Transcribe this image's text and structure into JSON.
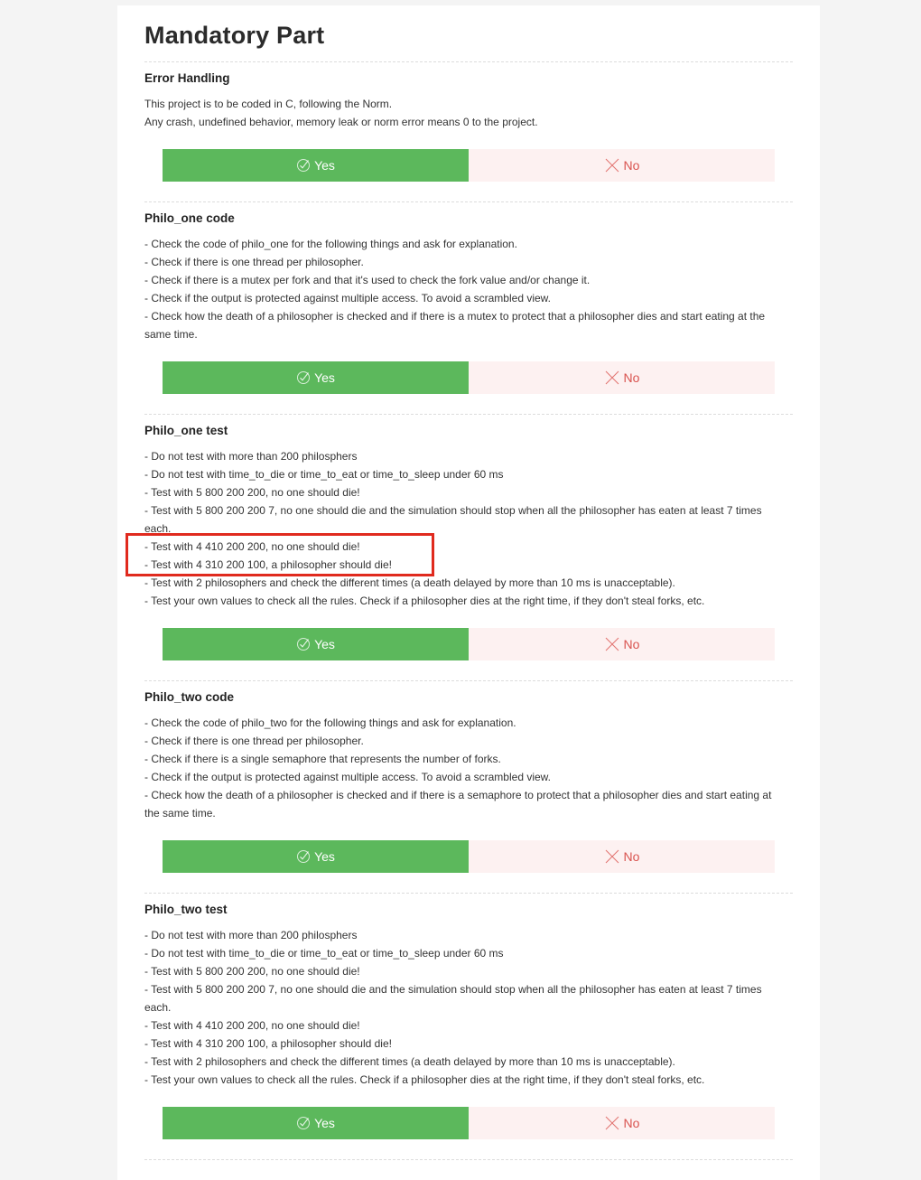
{
  "page": {
    "title": "Mandatory Part"
  },
  "colors": {
    "yes_bg": "#5cb85c",
    "no_bg": "#fdf1f1",
    "no_text": "#d9534f",
    "highlight": "#e02a1e"
  },
  "sections": [
    {
      "title": "Error Handling",
      "lines": [
        "This project is to be coded in C, following the Norm.",
        "Any crash, undefined behavior, memory leak or norm error means 0 to the project."
      ],
      "yes_label": "Yes",
      "no_label": "No"
    },
    {
      "title": "Philo_one code",
      "lines": [
        "- Check the code of philo_one for the following things and ask for explanation.",
        "- Check if there is one thread per philosopher.",
        "- Check if there is a mutex per fork and that it's used to check the fork value and/or change it.",
        "- Check if the output is protected against multiple access. To avoid a scrambled view.",
        "- Check how the death of a philosopher is checked and if there is a mutex to protect that a philosopher dies and start eating at the same time."
      ],
      "yes_label": "Yes",
      "no_label": "No"
    },
    {
      "title": "Philo_one test",
      "lines": [
        "- Do not test with more than 200 philosphers",
        "- Do not test with time_to_die or time_to_eat or time_to_sleep under 60 ms",
        "- Test with 5 800 200 200, no one should die!",
        "- Test with 5 800 200 200 7, no one should die and the simulation should stop when all the philosopher has eaten at least 7 times each.",
        "- Test with 4 410 200 200, no one should die!",
        "- Test with 4 310 200 100, a philosopher should die!",
        "- Test with 2 philosophers and check the different times (a death delayed by more than 10 ms is unacceptable).",
        "- Test your own values to check all the rules. Check if a philosopher dies at the right time, if they don't steal forks, etc."
      ],
      "yes_label": "Yes",
      "no_label": "No"
    },
    {
      "title": "Philo_two code",
      "lines": [
        "- Check the code of philo_two for the following things and ask for explanation.",
        "- Check if there is one thread per philosopher.",
        "- Check if there is a single semaphore that represents the number of forks.",
        "- Check if the output is protected against multiple access. To avoid a scrambled view.",
        "- Check how the death of a philosopher is checked and if there is a semaphore to protect that a philosopher dies and start eating at the same time."
      ],
      "yes_label": "Yes",
      "no_label": "No"
    },
    {
      "title": "Philo_two test",
      "lines": [
        "- Do not test with more than 200 philosphers",
        "- Do not test with time_to_die or time_to_eat or time_to_sleep under 60 ms",
        "- Test with 5 800 200 200, no one should die!",
        "- Test with 5 800 200 200 7, no one should die and the simulation should stop when all the philosopher has eaten at least 7 times each.",
        "- Test with 4 410 200 200, no one should die!",
        "- Test with 4 310 200 100, a philosopher should die!",
        "- Test with 2 philosophers and check the different times (a death delayed by more than 10 ms is unacceptable).",
        "- Test your own values to check all the rules. Check if a philosopher dies at the right time, if they don't steal forks, etc."
      ],
      "yes_label": "Yes",
      "no_label": "No"
    }
  ]
}
